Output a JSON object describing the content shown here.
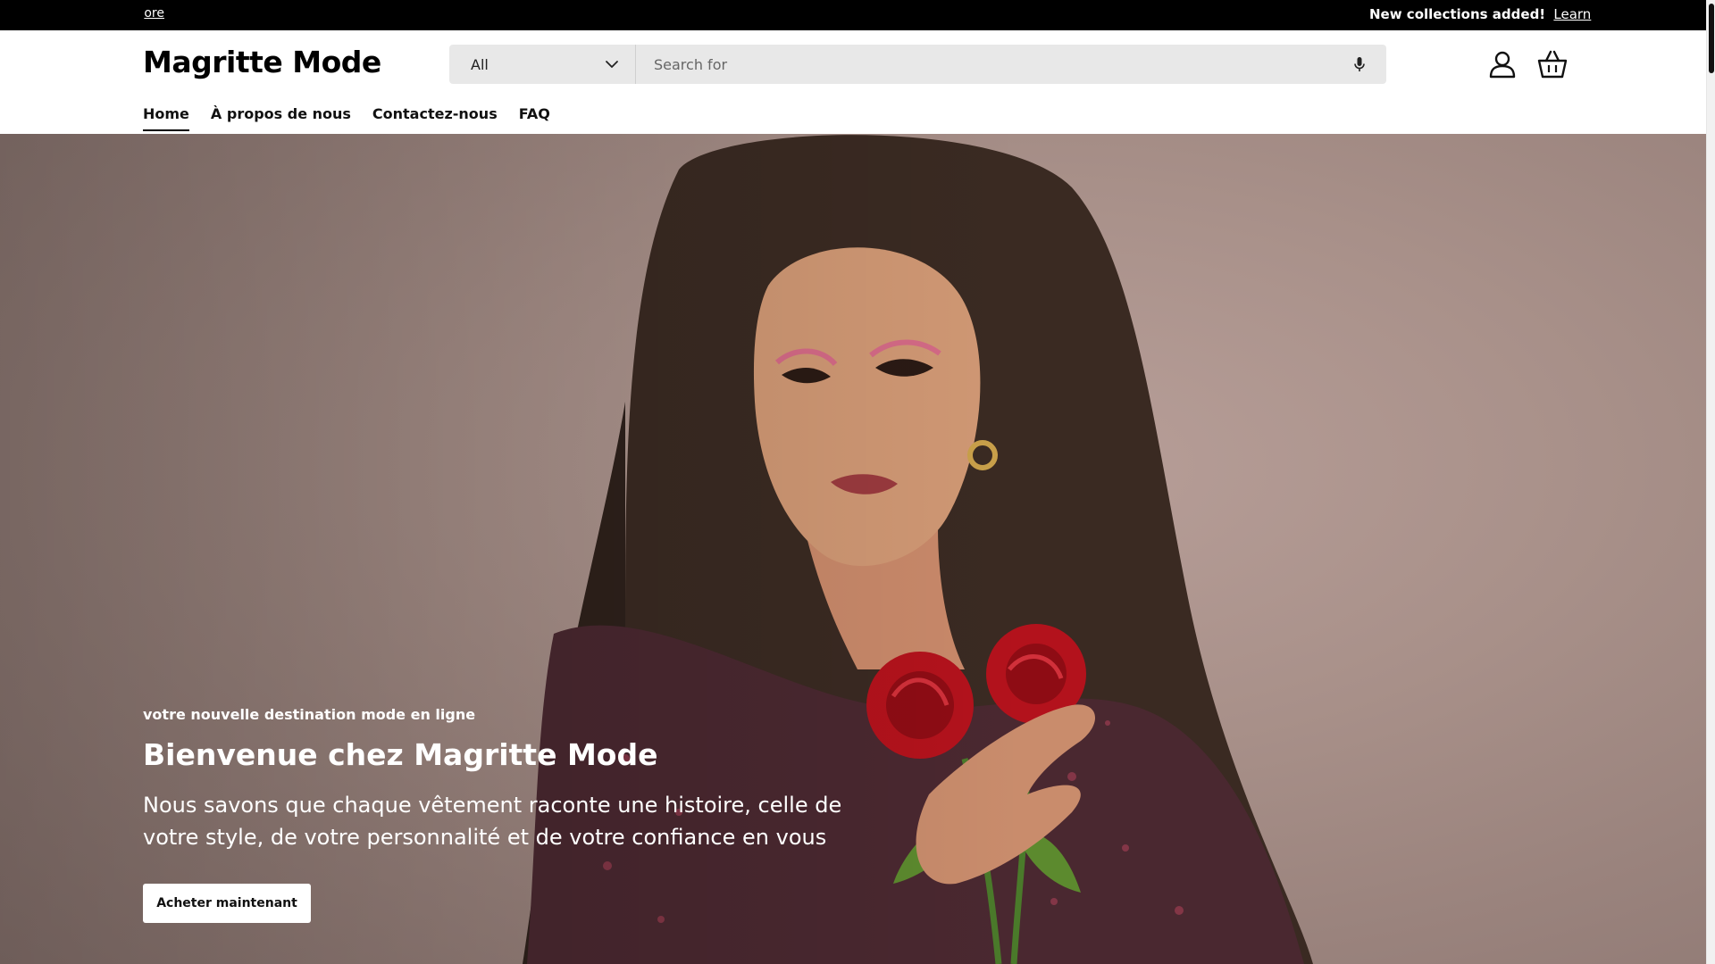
{
  "announcement": {
    "left_fragment": "ore",
    "message": "New collections added!",
    "link": "Learn"
  },
  "header": {
    "logo": "Magritte Mode",
    "search": {
      "category": "All",
      "placeholder": "Search for"
    },
    "icons": [
      "account-icon",
      "cart-icon",
      "microphone-icon",
      "chevron-down-icon"
    ]
  },
  "nav": {
    "items": [
      {
        "label": "Home",
        "active": true
      },
      {
        "label": "À propos de nous",
        "active": false
      },
      {
        "label": "Contactez-nous",
        "active": false
      },
      {
        "label": "FAQ",
        "active": false
      }
    ]
  },
  "hero": {
    "subtitle": "votre nouvelle destination mode en ligne",
    "headline": "Bienvenue chez Magritte Mode",
    "body": "Nous savons que chaque vêtement raconte une histoire, celle de votre style, de votre personnalité et de votre confiance en vous",
    "cta": "Acheter maintenant"
  },
  "colors": {
    "announcement_bg": "#000000",
    "hero_bg": "#a89089",
    "search_bg": "#e8e8e8",
    "rose": "#b3121c"
  }
}
